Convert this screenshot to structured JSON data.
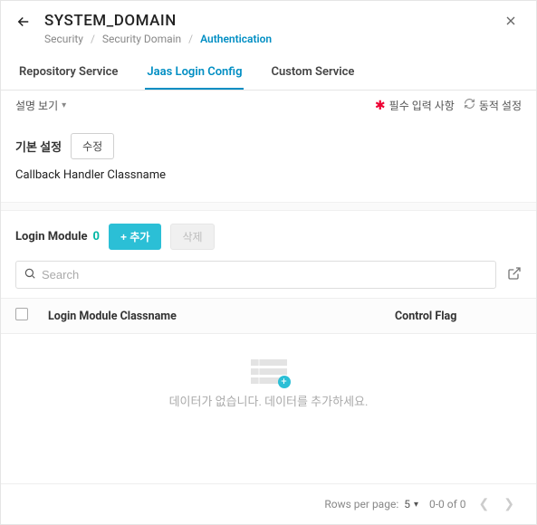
{
  "header": {
    "title": "SYSTEM_DOMAIN",
    "breadcrumb": [
      "Security",
      "Security Domain",
      "Authentication"
    ]
  },
  "tabs": [
    "Repository Service",
    "Jaas Login Config",
    "Custom Service"
  ],
  "active_tab": 1,
  "toolbar": {
    "desc_toggle": "설명 보기",
    "required_legend": "필수 입력 사항",
    "dynamic_legend": "동적 설정"
  },
  "basic": {
    "title": "기본 설정",
    "edit_btn": "수정",
    "field_label": "Callback Handler Classname"
  },
  "module": {
    "title": "Login Module",
    "count": "0",
    "add_btn": "+ 추가",
    "delete_btn": "삭제",
    "search_placeholder": "Search"
  },
  "table": {
    "col_name": "Login Module Classname",
    "col_flag": "Control Flag",
    "empty_msg": "데이터가 없습니다. 데이터를 추가하세요."
  },
  "pagination": {
    "label": "Rows per page:",
    "page_size": "5",
    "range": "0-0 of 0"
  }
}
